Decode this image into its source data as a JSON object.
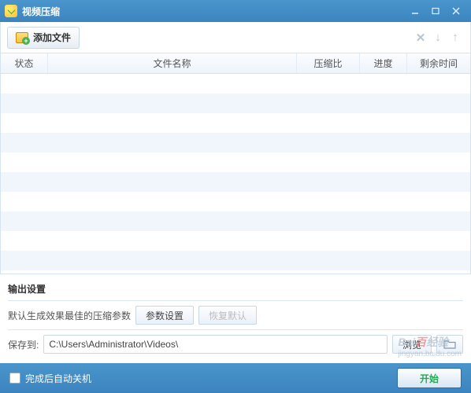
{
  "window": {
    "title": "视频压缩"
  },
  "toolbar": {
    "add_file": "添加文件"
  },
  "table": {
    "headers": {
      "status": "状态",
      "name": "文件名称",
      "ratio": "压缩比",
      "progress": "进度",
      "time": "剩余时间"
    },
    "rows": []
  },
  "output": {
    "section_title": "输出设置",
    "param_hint": "默认生成效果最佳的压缩参数",
    "param_btn": "参数设置",
    "reset_btn": "恢复默认",
    "save_to_label": "保存到:",
    "save_path": "C:\\Users\\Administrator\\Videos\\",
    "browse_btn": "浏览"
  },
  "footer": {
    "shutdown_label": "完成后自动关机",
    "start_btn": "开始"
  },
  "watermark": {
    "brand": "Bai",
    "suffix": "经验",
    "url": "jingyan.baidu.com"
  }
}
